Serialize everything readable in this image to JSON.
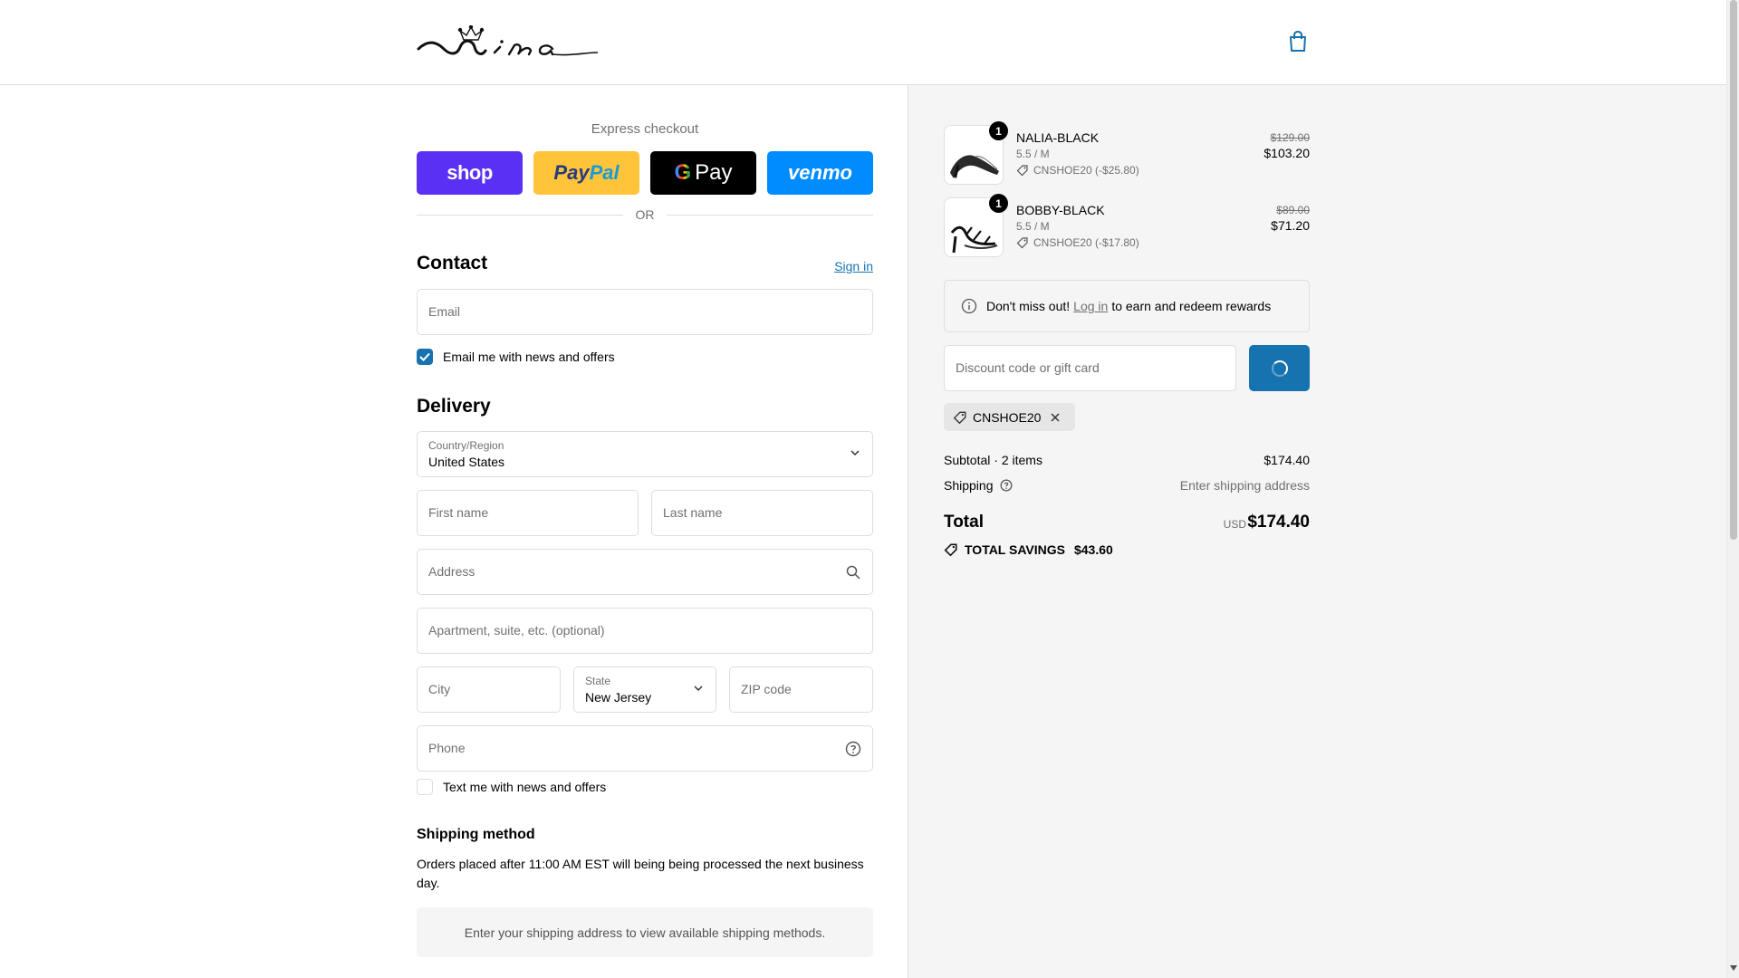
{
  "header": {
    "logo_text": "nina",
    "cart_icon": "shopping-bag-icon"
  },
  "express": {
    "label": "Express checkout",
    "shop": "shop",
    "paypal_a": "Pay",
    "paypal_b": "Pal",
    "gpay_g": "G",
    "gpay_text": "Pay",
    "venmo": "venmo",
    "or": "OR"
  },
  "contact": {
    "title": "Contact",
    "signin": "Sign in",
    "email_placeholder": "Email",
    "news_label": "Email me with news and offers"
  },
  "delivery": {
    "title": "Delivery",
    "country_label": "Country/Region",
    "country_value": "United States",
    "first_name": "First name",
    "last_name": "Last name",
    "address": "Address",
    "apartment": "Apartment, suite, etc. (optional)",
    "city": "City",
    "state_label": "State",
    "state_value": "New Jersey",
    "zip": "ZIP code",
    "phone": "Phone",
    "text_label": "Text me with news and offers"
  },
  "shipping_method": {
    "title": "Shipping method",
    "note": "Orders placed after 11:00 AM EST will being being processed the next business day.",
    "empty": "Enter your shipping address to view available shipping methods."
  },
  "cart": {
    "items": [
      {
        "qty": "1",
        "name": "NALIA-BLACK",
        "variant": "5.5 / M",
        "discount": "CNSHOE20 (-$25.80)",
        "original": "$129.00",
        "price": "$103.20"
      },
      {
        "qty": "1",
        "name": "BOBBY-BLACK",
        "variant": "5.5 / M",
        "discount": "CNSHOE20 (-$17.80)",
        "original": "$89.00",
        "price": "$71.20"
      }
    ],
    "notice_a": "Don't miss out!",
    "notice_link": "Log in",
    "notice_b": "to earn and redeem rewards",
    "discount_placeholder": "Discount code or gift card",
    "applied_code": "CNSHOE20",
    "subtotal_label": "Subtotal · 2 items",
    "subtotal_value": "$174.40",
    "shipping_label": "Shipping",
    "shipping_value": "Enter shipping address",
    "total_label": "Total",
    "currency": "USD",
    "total_value": "$174.40",
    "savings_label": "TOTAL SAVINGS",
    "savings_value": "$43.60"
  },
  "colors": {
    "accent": "#1773b0",
    "shop": "#5a31f4",
    "paypal": "#ffc439",
    "venmo": "#008cff"
  }
}
